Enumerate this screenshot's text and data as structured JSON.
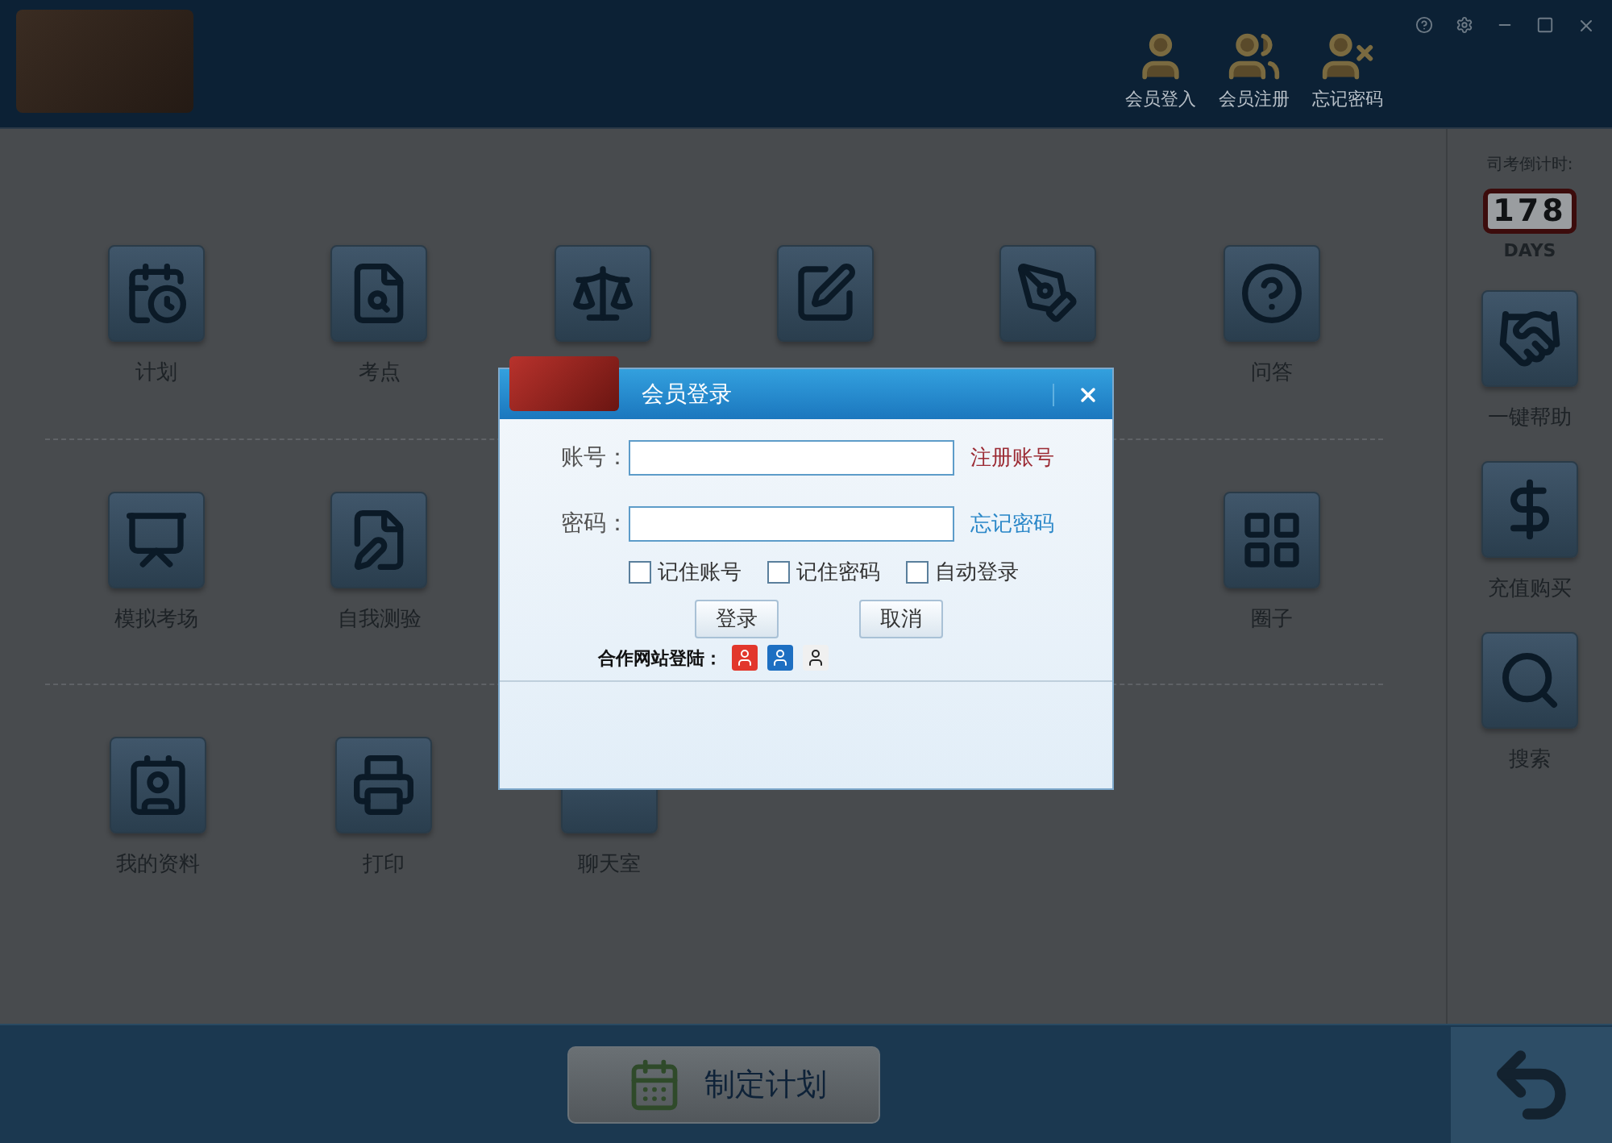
{
  "header": {
    "actions": [
      {
        "label": "会员登入",
        "kind": "login"
      },
      {
        "label": "会员注册",
        "kind": "register"
      },
      {
        "label": "忘记密码",
        "kind": "forgot"
      }
    ]
  },
  "grid": {
    "rows": [
      {
        "items": [
          {
            "kind": "plan",
            "label": "计划"
          },
          {
            "kind": "points",
            "label": "考点"
          },
          {
            "kind": "law"
          },
          {
            "kind": "exam"
          },
          {
            "kind": "mock"
          },
          {
            "kind": "qa",
            "label": "问答"
          }
        ]
      },
      {
        "items": [
          {
            "kind": "board",
            "label": "模拟考场"
          },
          {
            "kind": "selftest",
            "label": "自我测验"
          },
          {
            "kind": "none"
          },
          {
            "kind": "none"
          },
          {
            "kind": "none"
          },
          {
            "kind": "circle",
            "label": "圈子"
          }
        ]
      },
      {
        "items": [
          {
            "kind": "profile",
            "label": "我的资料"
          },
          {
            "kind": "print",
            "label": "打印"
          },
          {
            "kind": "chat",
            "label": "聊天室"
          }
        ]
      }
    ]
  },
  "sidebar": {
    "countdown_label": "司考倒计时:",
    "days": "178",
    "days_unit": "DAYS",
    "buttons": [
      {
        "kind": "help",
        "label": "一键帮助"
      },
      {
        "kind": "buy",
        "label": "充值购买"
      },
      {
        "kind": "search",
        "label": "搜索"
      }
    ]
  },
  "bottom": {
    "plan_button": "制定计划"
  },
  "dialog": {
    "title": "会员登录",
    "fields": [
      {
        "label": "账号：",
        "link": "注册账号",
        "color": "#9b2a33"
      },
      {
        "label": "密码：",
        "link": "忘记密码",
        "color": "#2a87c8"
      }
    ],
    "checkboxes": [
      {
        "label": "记住账号",
        "checked": false
      },
      {
        "label": "记住密码",
        "checked": false
      },
      {
        "label": "自动登录",
        "checked": false
      }
    ],
    "buttons": [
      "登录",
      "取消"
    ],
    "partner_label": "合作网站登陆：",
    "partners": [
      {
        "kind": "weibo"
      },
      {
        "kind": "renren"
      },
      {
        "kind": "qq"
      }
    ]
  }
}
